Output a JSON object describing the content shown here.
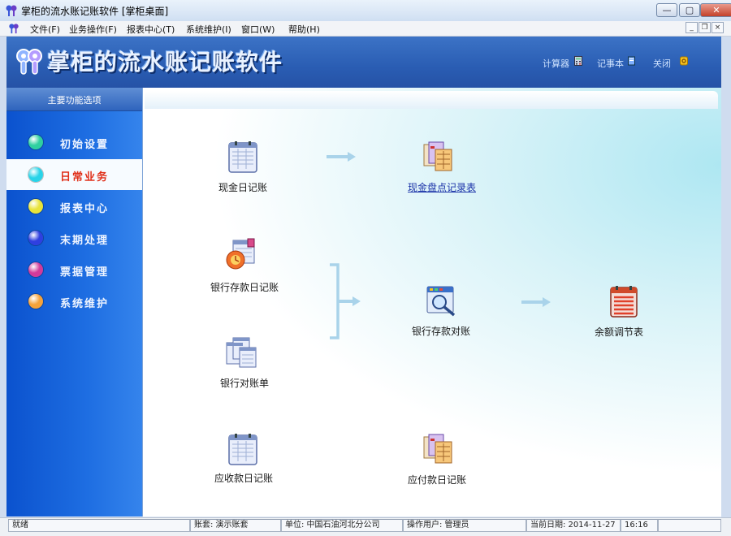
{
  "window": {
    "title": "掌柜的流水账记账软件  [掌柜桌面]",
    "minimize_label": "—",
    "maximize_label": "▢",
    "close_label": "✕"
  },
  "menu": {
    "items": [
      "文件(F)",
      "业务操作(F)",
      "报表中心(T)",
      "系统维护(I)",
      "窗口(W)",
      "帮助(H)"
    ],
    "mdi_minimize": "_",
    "mdi_restore": "❐",
    "mdi_close": "×"
  },
  "banner": {
    "title": "掌柜的流水账记账软件",
    "tools": [
      "计算器",
      "记事本",
      "关闭"
    ]
  },
  "sidebar": {
    "header": "主要功能选项",
    "items": [
      {
        "label": "初始设置",
        "color": "#2fd0a0"
      },
      {
        "label": "日常业务",
        "color": "#29d3e8"
      },
      {
        "label": "报表中心",
        "color": "#e8e33a"
      },
      {
        "label": "末期处理",
        "color": "#2f3fe0"
      },
      {
        "label": "票据管理",
        "color": "#d23a9a"
      },
      {
        "label": "系统维护",
        "color": "#f5a23a"
      }
    ],
    "active_index": 1
  },
  "flow": {
    "cash_journal": "现金日记账",
    "cash_count": "现金盘点记录表",
    "bank_journal": "银行存款日记账",
    "bank_statement": "银行对账单",
    "bank_reconcile": "银行存款对账",
    "balance_adjust": "余额调节表",
    "receivable_journal": "应收款日记账",
    "payable_journal": "应付款日记账"
  },
  "status": {
    "ready": "就绪",
    "account": "账套: 演示账套",
    "unit": "单位: 中国石油河北分公司",
    "user": "操作用户: 管理员",
    "date": "当前日期: 2014-11-27",
    "time": "16:16"
  },
  "colors": {
    "banner": "#2a5db3",
    "sidebar": "#1e6ee2",
    "active_label": "#e0301a",
    "link": "#1b33a8"
  }
}
